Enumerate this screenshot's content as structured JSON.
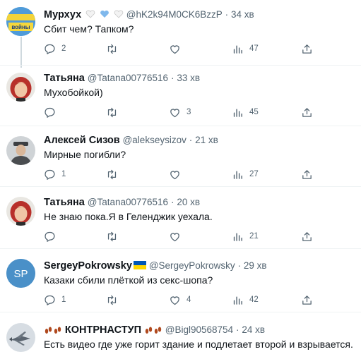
{
  "tweets": [
    {
      "name": "Мурхух",
      "handle": "@hK2k94M0CK6BzzP",
      "time": "34 хв",
      "text": "Сбит чем? Тапком?",
      "avatar_caption": "войны",
      "stats": {
        "reply": "2",
        "retweet": "",
        "like": "",
        "views": "47"
      }
    },
    {
      "name": "Татьяна",
      "handle": "@Tatana00776516",
      "time": "33 хв",
      "text": "Мухобойкой)",
      "stats": {
        "reply": "",
        "retweet": "",
        "like": "3",
        "views": "45"
      }
    },
    {
      "name": "Алексей Сизов",
      "handle": "@alekseysizov",
      "time": "21 хв",
      "text": "Мирные погибли?",
      "stats": {
        "reply": "1",
        "retweet": "",
        "like": "",
        "views": "27"
      }
    },
    {
      "name": "Татьяна",
      "handle": "@Tatana00776516",
      "time": "20 хв",
      "text": "Не знаю пока.Я в Геленджик уехала.",
      "stats": {
        "reply": "",
        "retweet": "",
        "like": "",
        "views": "21"
      }
    },
    {
      "name": "SergeyPokrowsky",
      "handle": "@SergeyPokrowsky",
      "time": "29 хв",
      "text": "Казаки сбили плёткой из секс-шопа?",
      "avatar_initials": "SP",
      "stats": {
        "reply": "1",
        "retweet": "",
        "like": "4",
        "views": "42"
      }
    },
    {
      "name": "КОНТРНАСТУП",
      "handle": "@Bigl90568754",
      "time": "24 хв",
      "text": "Есть видео где уже горит здание и подлетает второй и взрывается.",
      "stats": {
        "reply": "",
        "retweet": "",
        "like": "",
        "views": ""
      }
    }
  ],
  "separator": "·",
  "icons": {
    "reply": "reply-icon",
    "retweet": "retweet-icon",
    "like": "like-icon",
    "views": "views-icon",
    "share": "share-icon"
  },
  "colors": {
    "text": "#0f1419",
    "muted": "#536471",
    "thread_line": "#cfd9de",
    "sp_avatar": "#4a90c8",
    "ukraine_blue": "#0057b7",
    "ukraine_yellow": "#ffd700"
  }
}
